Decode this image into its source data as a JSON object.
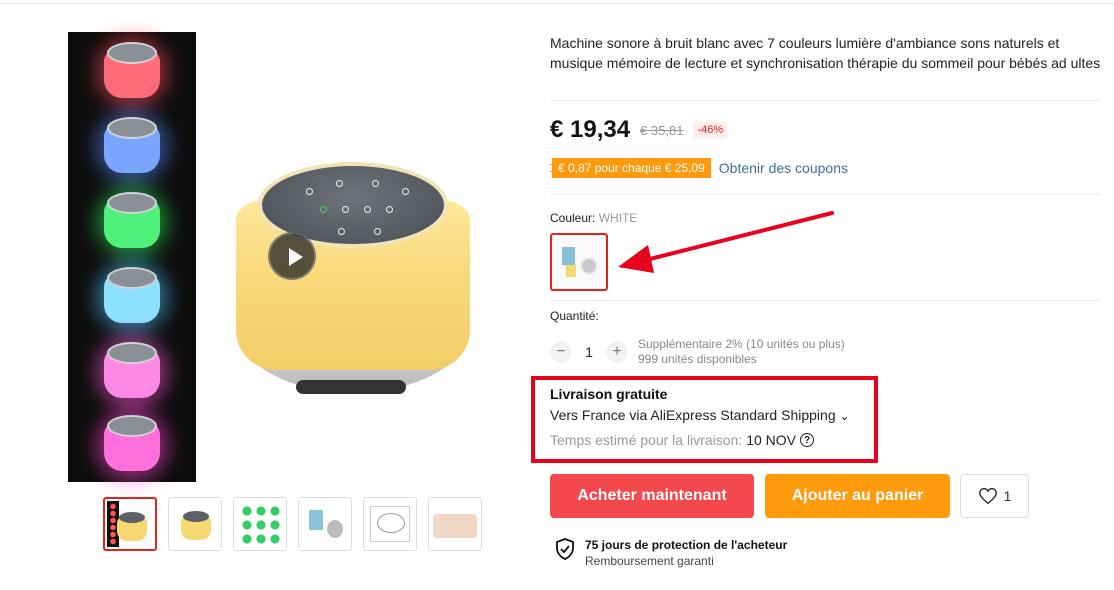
{
  "product": {
    "title": "Machine sonore à bruit blanc avec 7 couleurs lumière d'ambiance sons naturels et musique mémoire de lecture et synchronisation thérapie du sommeil pour bébés ad ultes",
    "price": "€ 19,34",
    "old_price": "€ 35,81",
    "discount": "-46%"
  },
  "coupon": {
    "badge": "€ 0,87 pour chaque € 25,09",
    "link": "Obtenir des coupons"
  },
  "color": {
    "label": "Couleur:",
    "value": "WHITE"
  },
  "quantity": {
    "label": "Quantité:",
    "minus": "−",
    "value": "1",
    "plus": "+",
    "extra": "Supplémentaire 2% (10 unités ou plus)",
    "available": "999 unités disponibles"
  },
  "shipping": {
    "title": "Livraison gratuite",
    "via": "Vers France via AliExpress Standard Shipping",
    "chevron": "⌄",
    "time_label": "Temps estimé pour la livraison:",
    "date": "10 NOV",
    "help": "?"
  },
  "actions": {
    "buy": "Acheter maintenant",
    "cart": "Ajouter au panier",
    "wishlist_count": "1"
  },
  "protection": {
    "line1": "75 jours de protection de l'acheteur",
    "line2": "Remboursement garanti"
  },
  "gallery": {
    "glow_colors": [
      "#ff4a5a",
      "#5a8cff",
      "#2fe05a",
      "#4fc8ff",
      "#ff5ad8",
      "#ff45d0"
    ]
  },
  "colors": {
    "accent_red": "#e1251b",
    "buy_button": "#f3484c",
    "cart_button": "#ff9a0d",
    "coupon_badge": "#ff9a0d",
    "annotation_red": "#e8001c"
  },
  "icons": [
    "play-icon",
    "heart-icon",
    "shield-check-icon",
    "help-icon",
    "chevron-down-icon",
    "annotation-arrow"
  ]
}
